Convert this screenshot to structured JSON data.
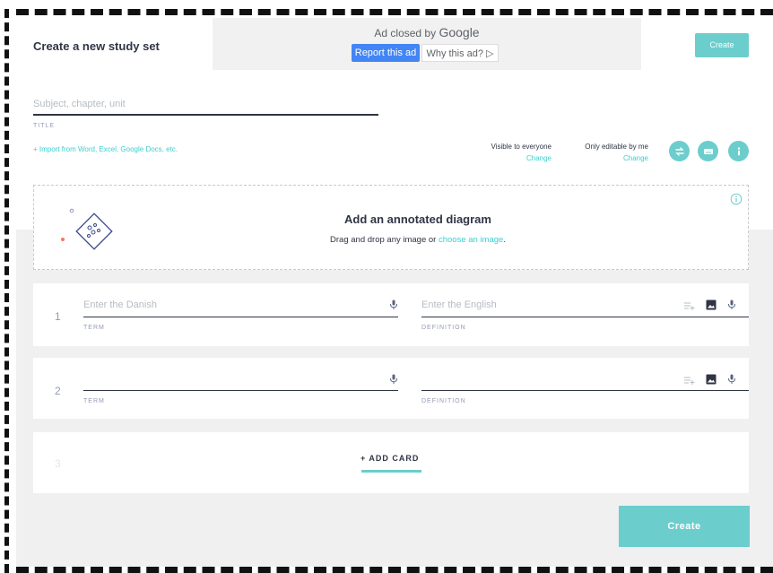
{
  "header": {
    "title": "Create a new study set",
    "create_label": "Create"
  },
  "ad": {
    "closed_text": "Ad closed by",
    "brand": "Google",
    "report_label": "Report this ad",
    "why_label": "Why this ad? ▷"
  },
  "title_field": {
    "placeholder": "Subject, chapter, unit",
    "label": "TITLE"
  },
  "import_link": "+ Import from Word, Excel, Google Docs, etc.",
  "visibility": {
    "visible_text": "Visible to everyone",
    "visible_change": "Change",
    "editable_text": "Only editable by me",
    "editable_change": "Change"
  },
  "action_icons": [
    "swap-icon",
    "keyboard-icon",
    "info-icon"
  ],
  "diagram": {
    "title": "Add an annotated diagram",
    "subtitle": "Drag and drop any image or",
    "link": "choose an image",
    "period": "."
  },
  "cards": [
    {
      "number": "1",
      "term_placeholder": "Enter the Danish",
      "term_label": "TERM",
      "definition_placeholder": "Enter the English",
      "definition_label": "DEFINITION"
    },
    {
      "number": "2",
      "term_placeholder": "",
      "term_label": "TERM",
      "definition_placeholder": "",
      "definition_label": "DEFINITION"
    }
  ],
  "add_card": {
    "number": "3",
    "label": "+ ADD CARD"
  },
  "footer": {
    "create_label": "Create"
  },
  "colors": {
    "accent": "#6ccdcd",
    "link": "#3ccfcf",
    "text": "#303545",
    "muted": "#939bb4",
    "ad_blue": "#4285f4"
  }
}
